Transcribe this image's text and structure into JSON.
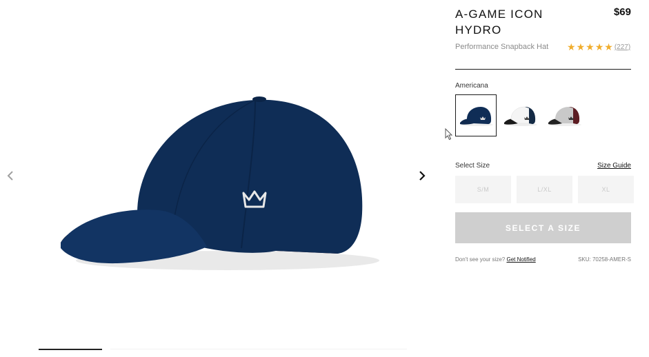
{
  "product": {
    "title": "A-GAME ICON HYDRO",
    "price": "$69",
    "subtitle": "Performance Snapback Hat",
    "rating_stars": 5,
    "review_count": "(227)",
    "sku": "SKU: 70258-AMER-S"
  },
  "color": {
    "label": "Americana",
    "swatches": [
      {
        "name": "navy",
        "selected": true
      },
      {
        "name": "white-navy",
        "selected": false
      },
      {
        "name": "gray-maroon",
        "selected": false
      }
    ]
  },
  "size": {
    "label": "Select Size",
    "guide_link": "Size Guide",
    "options": [
      "S/M",
      "L/XL",
      "XL"
    ]
  },
  "cta": {
    "label": "SELECT A SIZE"
  },
  "notify": {
    "text": "Don't see your size?",
    "link": "Get Notified"
  },
  "colors": {
    "accent_star": "#f0ad2d",
    "hat_navy": "#0f2d56",
    "cta_disabled": "#cfcfcf"
  }
}
